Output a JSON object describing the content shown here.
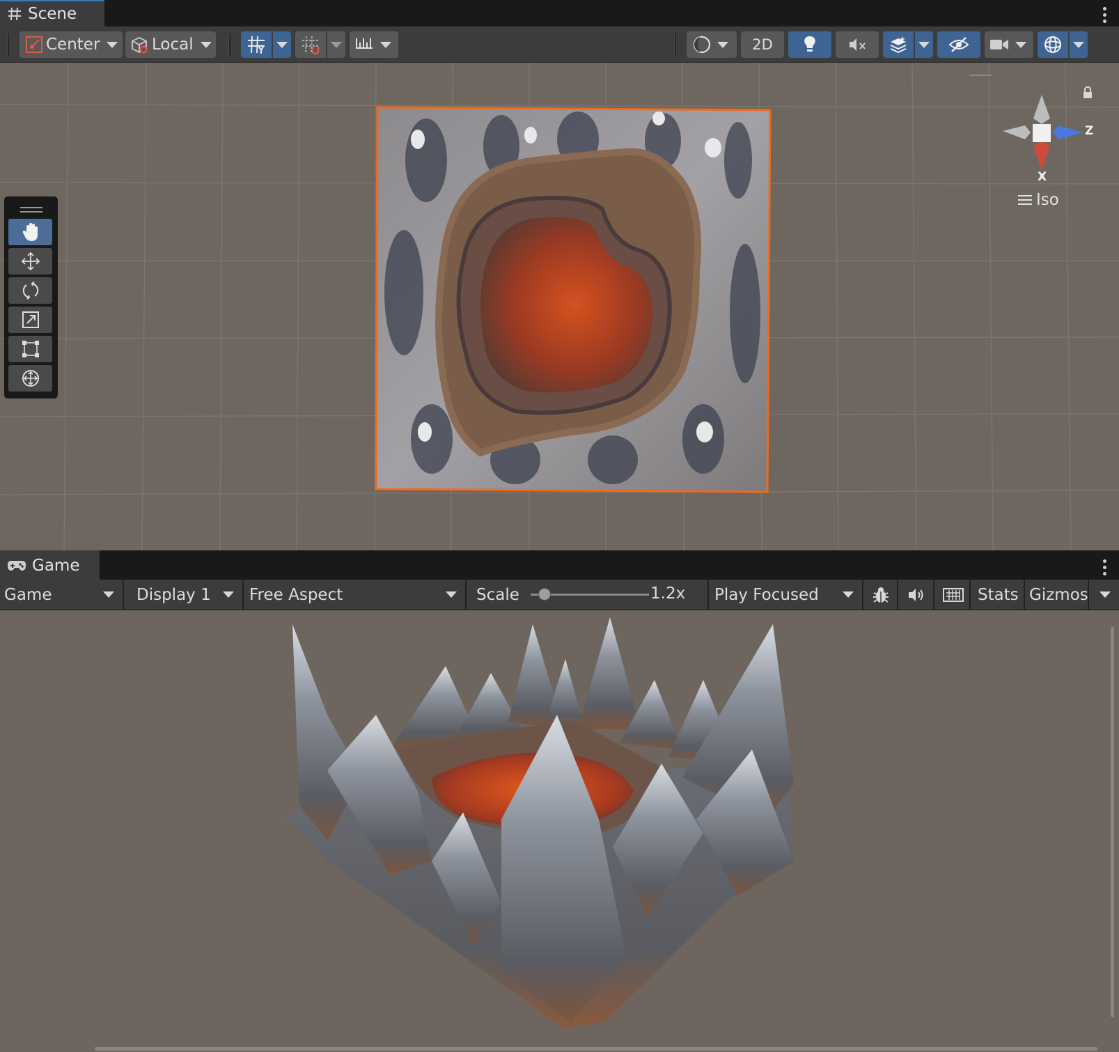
{
  "scene": {
    "tab_label": "Scene",
    "pivot_label": "Center",
    "space_label": "Local",
    "mode_2d_label": "2D",
    "gizmo_axis_z": "Z",
    "gizmo_axis_x": "X",
    "projection_label": "Iso",
    "selection_outline_color": "#f26a1b"
  },
  "game": {
    "tab_label": "Game",
    "view_select": "Game",
    "display_select": "Display 1",
    "aspect_select": "Free Aspect",
    "scale_label": "Scale",
    "scale_value": "1.2x",
    "scale_slider_fraction": 0.12,
    "play_mode_select": "Play Focused",
    "stats_label": "Stats",
    "gizmos_label": "Gizmos"
  },
  "colors": {
    "accent_blue": "#3e6493",
    "lava": "#c8461c",
    "scene_bg": "#6e675f"
  }
}
